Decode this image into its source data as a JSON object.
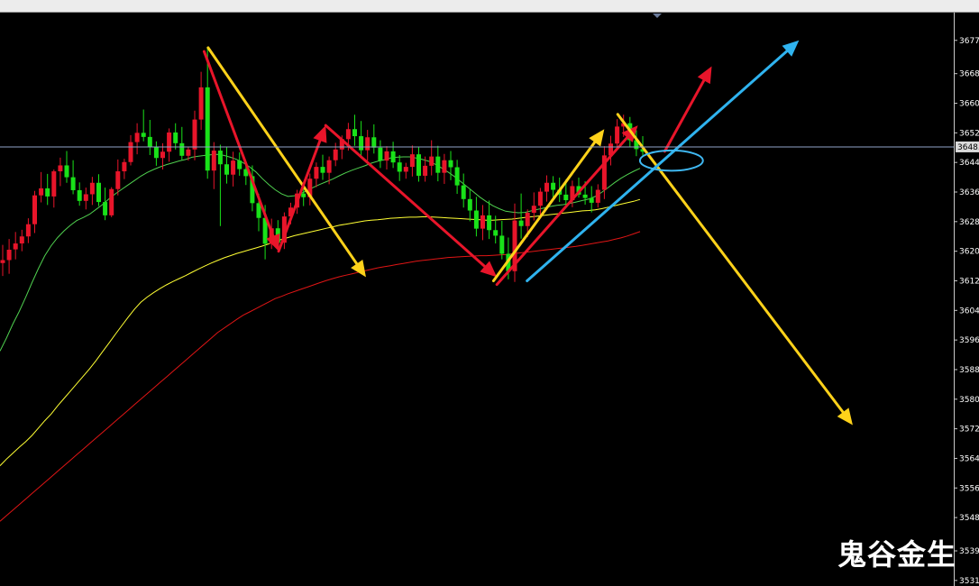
{
  "chart_data": {
    "type": "candlestick",
    "title": "",
    "yaxis": {
      "ticks": [
        3677,
        3668,
        3660,
        3652,
        3644,
        3636,
        3628,
        3620,
        3612,
        3604,
        3596,
        3588,
        3580,
        3572,
        3564,
        3556,
        3548,
        3539,
        3531
      ],
      "tick_labels": [
        "3677.",
        "3668.",
        "3660.",
        "3652.",
        "3644.",
        "3636.",
        "3628.",
        "3620.",
        "3612.",
        "3604.",
        "3596.",
        "3588.",
        "3580.",
        "3572.",
        "3564.",
        "3556.",
        "3548.",
        "3539.",
        "3531."
      ],
      "range": [
        3529.5,
        3684.5
      ]
    },
    "current_price_label": "3648.",
    "current_price": 3648.2,
    "colors": {
      "up": "#e8152a",
      "down": "#19e219",
      "ma_fast": "#4fd04f",
      "ma_mid": "#ffff33",
      "ma_slow": "#e01515",
      "arrow_red": "#e8152a",
      "arrow_yellow": "#ffd21a",
      "arrow_blue": "#2fb3ef",
      "ellipse": "#3fb8f2",
      "price_line": "#8fa3c8"
    },
    "candles": [
      [
        3616.8,
        3621.7,
        3613.3,
        3617.6
      ],
      [
        3617.6,
        3623.3,
        3613.9,
        3620.4
      ],
      [
        3620.5,
        3625.2,
        3617.8,
        3622.1
      ],
      [
        3622.1,
        3625.8,
        3620.0,
        3624.0
      ],
      [
        3624.0,
        3628.9,
        3622.2,
        3627.3
      ],
      [
        3627.3,
        3636.3,
        3624.9,
        3635.1
      ],
      [
        3635.1,
        3641.4,
        3633.2,
        3637.0
      ],
      [
        3637.0,
        3640.9,
        3632.5,
        3634.8
      ],
      [
        3634.8,
        3642.1,
        3631.8,
        3641.6
      ],
      [
        3641.6,
        3645.3,
        3637.6,
        3643.2
      ],
      [
        3643.2,
        3647.1,
        3638.5,
        3640.0
      ],
      [
        3640.0,
        3644.6,
        3635.4,
        3636.5
      ],
      [
        3636.5,
        3638.6,
        3632.3,
        3633.6
      ],
      [
        3633.6,
        3637.2,
        3631.3,
        3635.4
      ],
      [
        3635.4,
        3640.1,
        3632.5,
        3638.5
      ],
      [
        3638.5,
        3640.8,
        3632.2,
        3633.3
      ],
      [
        3633.3,
        3637.2,
        3628.4,
        3629.7
      ],
      [
        3629.7,
        3637.3,
        3629.2,
        3636.8
      ],
      [
        3636.8,
        3644.8,
        3635.1,
        3641.6
      ],
      [
        3641.6,
        3645.0,
        3639.5,
        3644.1
      ],
      [
        3644.1,
        3651.4,
        3643.2,
        3649.5
      ],
      [
        3649.5,
        3654.6,
        3646.2,
        3652.0
      ],
      [
        3652.0,
        3658.3,
        3649.7,
        3650.9
      ],
      [
        3650.9,
        3655.5,
        3646.0,
        3648.3
      ],
      [
        3648.3,
        3649.7,
        3643.1,
        3645.2
      ],
      [
        3645.2,
        3649.2,
        3642.1,
        3646.9
      ],
      [
        3646.9,
        3653.2,
        3644.2,
        3652.1
      ],
      [
        3652.1,
        3654.6,
        3647.5,
        3649.2
      ],
      [
        3649.2,
        3653.6,
        3644.7,
        3645.8
      ],
      [
        3645.8,
        3648.3,
        3644.5,
        3647.5
      ],
      [
        3647.5,
        3658.0,
        3644.6,
        3655.6
      ],
      [
        3655.6,
        3668.5,
        3652.8,
        3664.3
      ],
      [
        3664.3,
        3675.3,
        3639.6,
        3641.8
      ],
      [
        3641.8,
        3649.5,
        3636.8,
        3647.2
      ],
      [
        3647.2,
        3648.8,
        3626.8,
        3643.5
      ],
      [
        3643.5,
        3648.3,
        3638.3,
        3640.7
      ],
      [
        3640.7,
        3646.9,
        3637.5,
        3644.5
      ],
      [
        3644.5,
        3646.7,
        3640.4,
        3642.2
      ],
      [
        3642.2,
        3643.8,
        3637.9,
        3640.3
      ],
      [
        3640.3,
        3643.2,
        3630.8,
        3633.0
      ],
      [
        3633.0,
        3635.5,
        3625.4,
        3629.0
      ],
      [
        3629.0,
        3632.5,
        3617.8,
        3622.0
      ],
      [
        3622.0,
        3628.8,
        3620.6,
        3626.2
      ],
      [
        3626.2,
        3628.4,
        3620.9,
        3622.3
      ],
      [
        3622.3,
        3630.5,
        3620.6,
        3629.4
      ],
      [
        3629.4,
        3633.1,
        3627.3,
        3631.8
      ],
      [
        3631.8,
        3636.6,
        3630.1,
        3635.6
      ],
      [
        3635.6,
        3638.3,
        3632.2,
        3634.6
      ],
      [
        3634.6,
        3641.0,
        3632.4,
        3639.6
      ],
      [
        3639.6,
        3644.0,
        3637.3,
        3642.8
      ],
      [
        3642.8,
        3646.1,
        3639.3,
        3641.2
      ],
      [
        3641.2,
        3645.6,
        3638.1,
        3644.6
      ],
      [
        3644.6,
        3649.3,
        3643.0,
        3647.5
      ],
      [
        3647.5,
        3651.3,
        3644.9,
        3650.3
      ],
      [
        3650.3,
        3654.7,
        3647.2,
        3653.0
      ],
      [
        3653.0,
        3656.9,
        3648.5,
        3651.1
      ],
      [
        3651.1,
        3655.2,
        3645.1,
        3647.3
      ],
      [
        3647.3,
        3652.8,
        3644.5,
        3650.8
      ],
      [
        3650.8,
        3654.3,
        3646.4,
        3648.0
      ],
      [
        3648.0,
        3650.0,
        3642.5,
        3644.5
      ],
      [
        3644.5,
        3648.4,
        3642.1,
        3647.0
      ],
      [
        3647.0,
        3649.6,
        3642.5,
        3644.0
      ],
      [
        3644.0,
        3646.0,
        3639.0,
        3641.5
      ],
      [
        3641.5,
        3643.9,
        3639.6,
        3642.8
      ],
      [
        3642.8,
        3648.6,
        3640.2,
        3646.2
      ],
      [
        3646.2,
        3648.2,
        3638.8,
        3640.4
      ],
      [
        3640.4,
        3645.6,
        3638.8,
        3643.1
      ],
      [
        3643.1,
        3650.0,
        3640.5,
        3645.6
      ],
      [
        3645.6,
        3648.5,
        3638.9,
        3641.2
      ],
      [
        3641.2,
        3646.3,
        3638.2,
        3644.6
      ],
      [
        3644.6,
        3647.1,
        3639.2,
        3642.7
      ],
      [
        3642.7,
        3644.7,
        3635.5,
        3637.8
      ],
      [
        3637.8,
        3641.0,
        3631.8,
        3634.1
      ],
      [
        3634.1,
        3636.7,
        3628.1,
        3631.0
      ],
      [
        3631.0,
        3634.7,
        3624.0,
        3626.1
      ],
      [
        3626.1,
        3632.5,
        3623.0,
        3629.7
      ],
      [
        3629.7,
        3633.7,
        3623.3,
        3625.7
      ],
      [
        3625.7,
        3629.6,
        3622.1,
        3624.2
      ],
      [
        3624.2,
        3628.2,
        3617.8,
        3619.3
      ],
      [
        3619.3,
        3623.7,
        3612.4,
        3614.6
      ],
      [
        3614.6,
        3632.9,
        3611.7,
        3628.3
      ],
      [
        3628.3,
        3635.6,
        3623.4,
        3626.8
      ],
      [
        3626.8,
        3631.3,
        3623.8,
        3630.4
      ],
      [
        3630.4,
        3635.9,
        3628.3,
        3632.3
      ],
      [
        3632.3,
        3637.1,
        3629.8,
        3636.1
      ],
      [
        3636.1,
        3640.5,
        3633.4,
        3638.5
      ],
      [
        3638.5,
        3640.3,
        3634.2,
        3636.6
      ],
      [
        3636.6,
        3639.9,
        3633.3,
        3635.3
      ],
      [
        3635.3,
        3639.4,
        3632.3,
        3633.8
      ],
      [
        3633.8,
        3639.1,
        3631.9,
        3637.6
      ],
      [
        3637.6,
        3639.9,
        3634.5,
        3635.3
      ],
      [
        3635.3,
        3638.9,
        3632.6,
        3634.4
      ],
      [
        3634.4,
        3637.6,
        3630.5,
        3633.1
      ],
      [
        3633.1,
        3638.1,
        3631.8,
        3636.6
      ],
      [
        3636.6,
        3648.4,
        3634.1,
        3645.9
      ],
      [
        3645.9,
        3651.2,
        3643.2,
        3649.1
      ],
      [
        3649.1,
        3655.7,
        3647.4,
        3653.7
      ],
      [
        3653.7,
        3656.9,
        3650.9,
        3654.6
      ],
      [
        3654.6,
        3656.3,
        3648.3,
        3650.0
      ],
      [
        3650.0,
        3652.7,
        3645.7,
        3647.6
      ],
      [
        3647.6,
        3651.1,
        3645.7,
        3646.9
      ]
    ],
    "ma_fast": [
      3593,
      3596.5,
      3600.3,
      3603.7,
      3607.5,
      3611.5,
      3615.3,
      3618.8,
      3621.5,
      3623.7,
      3625.5,
      3627.0,
      3628.3,
      3629.1,
      3630.0,
      3631.3,
      3632.6,
      3634.1,
      3635.5,
      3636.7,
      3637.9,
      3639.1,
      3640.3,
      3641.3,
      3642.1,
      3642.8,
      3643.4,
      3643.9,
      3644.4,
      3644.8,
      3645.4,
      3645.7,
      3645.9,
      3646.1,
      3646.2,
      3645.9,
      3645.4,
      3644.8,
      3643.9,
      3642.8,
      3641.4,
      3639.6,
      3638.0,
      3636.6,
      3635.5,
      3634.8,
      3635.0,
      3635.6,
      3636.4,
      3637.3,
      3638.1,
      3638.8,
      3639.5,
      3640.4,
      3641.2,
      3641.9,
      3642.5,
      3643.1,
      3643.8,
      3644.3,
      3644.7,
      3645.2,
      3645.4,
      3645.5,
      3645.5,
      3645.2,
      3644.8,
      3644.3,
      3643.5,
      3642.5,
      3641.4,
      3640.2,
      3638.8,
      3637.4,
      3636.0,
      3634.6,
      3633.4,
      3632.3,
      3631.5,
      3630.8,
      3630.6,
      3630.4,
      3630.5,
      3630.9,
      3631.3,
      3631.7,
      3632.1,
      3632.4,
      3632.6,
      3632.9,
      3633.3,
      3633.7,
      3634.1,
      3634.8,
      3635.9,
      3637.2,
      3638.5,
      3639.7,
      3640.7,
      3641.6,
      3642.4
    ],
    "ma_mid": [
      3562,
      3563.8,
      3565.4,
      3567.0,
      3568.5,
      3570.2,
      3572.2,
      3574.2,
      3576.0,
      3578.2,
      3580.2,
      3582.2,
      3584.2,
      3586.2,
      3588.2,
      3590.4,
      3592.8,
      3595.1,
      3597.5,
      3599.8,
      3602.1,
      3604.3,
      3606.2,
      3607.6,
      3608.8,
      3609.9,
      3610.9,
      3611.8,
      3612.6,
      3613.4,
      3614.3,
      3615.2,
      3616.0,
      3616.8,
      3617.5,
      3618.2,
      3618.8,
      3619.4,
      3619.9,
      3620.4,
      3620.9,
      3621.4,
      3622.0,
      3622.6,
      3623.2,
      3623.7,
      3624.2,
      3624.6,
      3625.0,
      3625.4,
      3625.8,
      3626.2,
      3626.6,
      3627.0,
      3627.3,
      3627.6,
      3627.9,
      3628.2,
      3628.4,
      3628.5,
      3628.7,
      3628.9,
      3629.0,
      3629.1,
      3629.2,
      3629.2,
      3629.3,
      3629.3,
      3629.2,
      3629.1,
      3629.0,
      3628.9,
      3628.8,
      3628.7,
      3628.6,
      3628.5,
      3628.4,
      3628.4,
      3628.5,
      3628.6,
      3628.7,
      3628.9,
      3629.1,
      3629.3,
      3629.5,
      3629.7,
      3629.9,
      3630.1,
      3630.3,
      3630.5,
      3630.7,
      3630.9,
      3631.0,
      3631.2,
      3631.5,
      3631.9,
      3632.3,
      3632.7,
      3633.1,
      3633.5,
      3634.0
    ],
    "ma_slow": [
      3547,
      3548.5,
      3550.0,
      3551.5,
      3553.0,
      3554.5,
      3556.0,
      3557.5,
      3559.0,
      3560.5,
      3562.0,
      3563.5,
      3565.0,
      3566.5,
      3568.0,
      3569.5,
      3571.0,
      3572.5,
      3574.0,
      3575.5,
      3577.0,
      3578.5,
      3580.0,
      3581.5,
      3583.0,
      3584.5,
      3586.0,
      3587.5,
      3589.0,
      3590.5,
      3592.0,
      3593.5,
      3595.0,
      3596.5,
      3598.0,
      3599.2,
      3600.4,
      3601.6,
      3602.7,
      3603.6,
      3604.5,
      3605.4,
      3606.3,
      3607.2,
      3607.8,
      3608.5,
      3609.1,
      3609.7,
      3610.3,
      3610.9,
      3611.5,
      3612.1,
      3612.6,
      3613.1,
      3613.5,
      3613.9,
      3614.3,
      3614.7,
      3615.1,
      3615.5,
      3615.8,
      3616.1,
      3616.4,
      3616.7,
      3617.0,
      3617.3,
      3617.5,
      3617.7,
      3617.9,
      3618.1,
      3618.3,
      3618.4,
      3618.5,
      3618.6,
      3618.7,
      3618.8,
      3618.8,
      3618.9,
      3619.0,
      3619.1,
      3619.3,
      3619.5,
      3619.7,
      3619.9,
      3620.1,
      3620.3,
      3620.5,
      3620.7,
      3620.9,
      3621.1,
      3621.3,
      3621.6,
      3621.9,
      3622.2,
      3622.5,
      3622.8,
      3623.2,
      3623.6,
      3624.1,
      3624.7,
      3625.3
    ]
  },
  "annotations": {
    "arrows": [
      {
        "color": "arrow_yellow",
        "from": [
          0.31,
          3675.0
        ],
        "to": [
          0.545,
          3613.0
        ]
      },
      {
        "color": "arrow_red",
        "from": [
          0.304,
          3674.0
        ],
        "to": [
          0.415,
          3620.0
        ]
      },
      {
        "color": "arrow_red",
        "from": [
          0.415,
          3620.0
        ],
        "to": [
          0.485,
          3654.0
        ]
      },
      {
        "color": "arrow_red",
        "from": [
          0.485,
          3654.0
        ],
        "to": [
          0.74,
          3613.0
        ]
      },
      {
        "color": "arrow_red",
        "from": [
          0.74,
          3611.0
        ],
        "to": [
          0.95,
          3654.0
        ]
      },
      {
        "color": "arrow_yellow",
        "from": [
          0.735,
          3612.0
        ],
        "to": [
          0.9,
          3653.0
        ]
      },
      {
        "color": "arrow_yellow",
        "from": [
          0.92,
          3657.0
        ],
        "to": [
          1.27,
          3573.0
        ]
      },
      {
        "color": "arrow_red",
        "from": [
          0.99,
          3647.0
        ],
        "to": [
          1.06,
          3670.0
        ]
      },
      {
        "color": "arrow_blue",
        "from": [
          0.785,
          3612.0
        ],
        "to": [
          1.19,
          3677.0
        ]
      }
    ],
    "ellipse": {
      "center": [
        1.0,
        3644.5
      ],
      "rx_frac": 0.055,
      "ry_price": 2.5
    },
    "watermark": "鬼谷金生"
  }
}
